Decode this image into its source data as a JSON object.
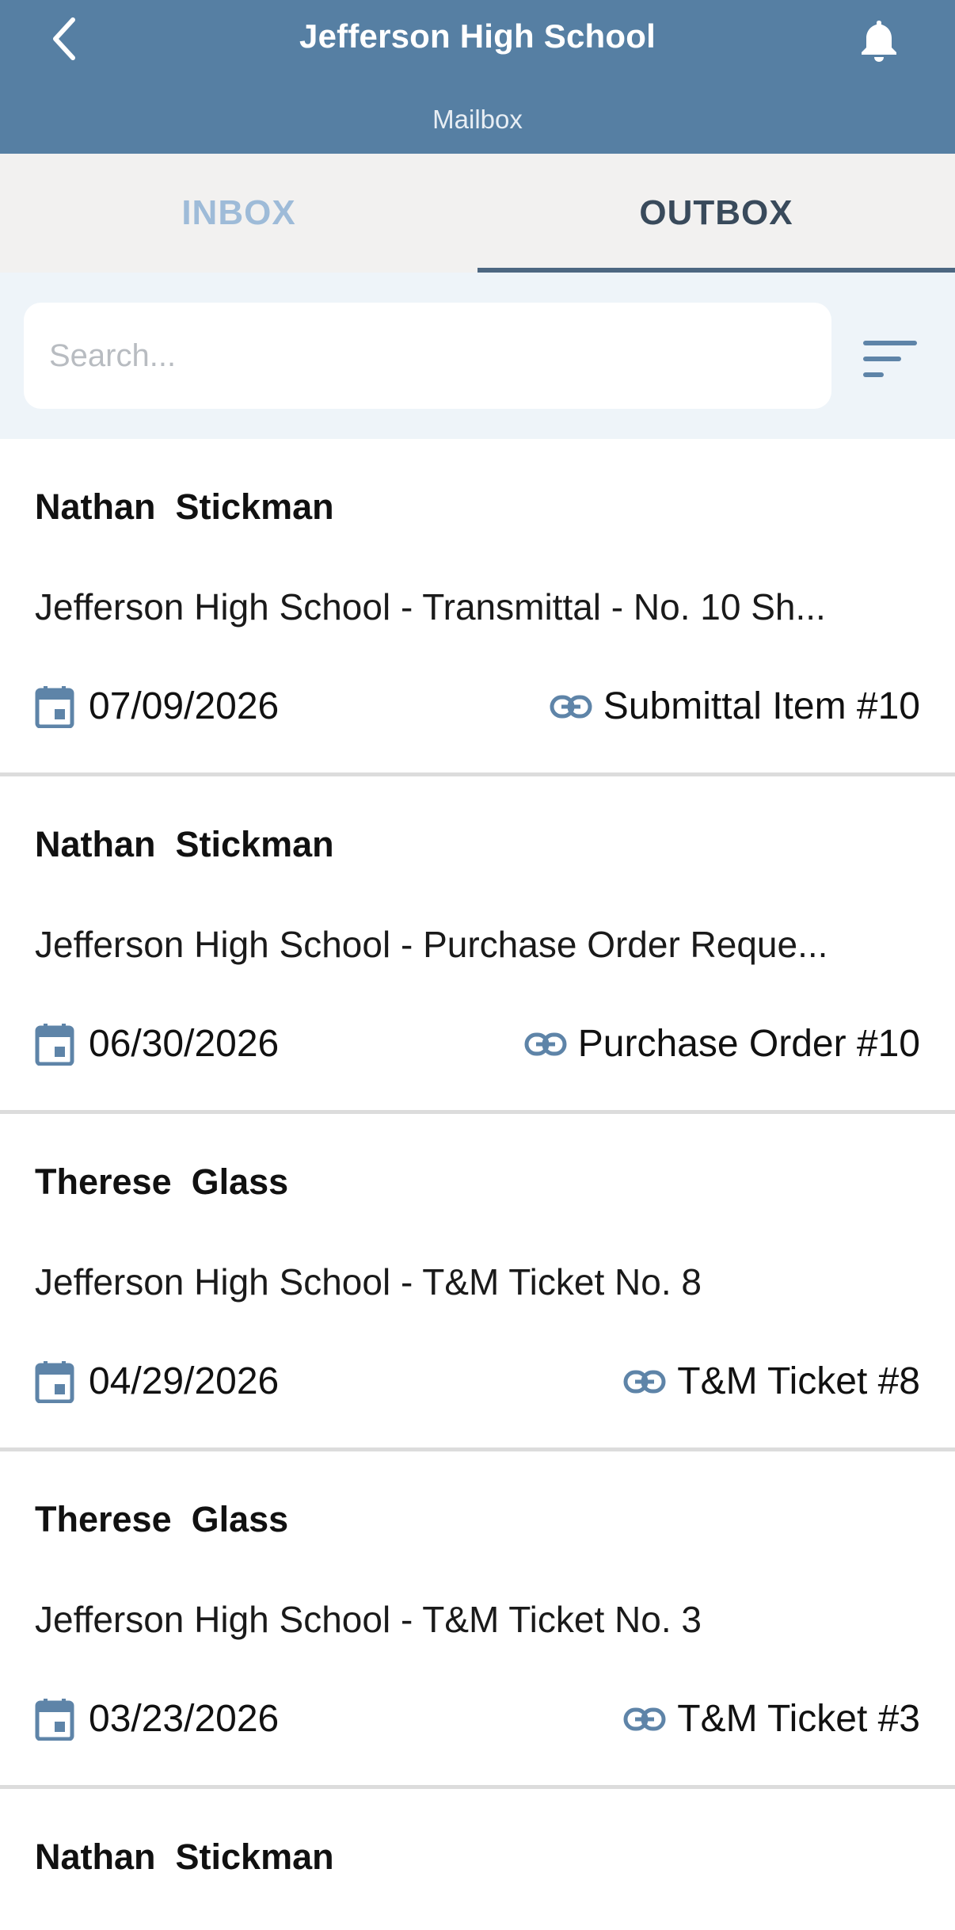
{
  "header": {
    "title": "Jefferson High School",
    "subtitle": "Mailbox",
    "back_icon": "chevron-left-icon",
    "bell_icon": "bell-icon"
  },
  "tabs": [
    {
      "label": "INBOX",
      "active": false
    },
    {
      "label": "OUTBOX",
      "active": true
    }
  ],
  "search": {
    "placeholder": "Search...",
    "value": ""
  },
  "messages": [
    {
      "sender": "Nathan  Stickman",
      "subject": "Jefferson High School - Transmittal - No. 10 Sh...",
      "date": "07/09/2026",
      "reference": "Submittal Item #10"
    },
    {
      "sender": "Nathan  Stickman",
      "subject": "Jefferson High School - Purchase Order Reque...",
      "date": "06/30/2026",
      "reference": "Purchase Order #10"
    },
    {
      "sender": "Therese  Glass",
      "subject": "Jefferson High School - T&M Ticket No. 8",
      "date": "04/29/2026",
      "reference": "T&M Ticket #8"
    },
    {
      "sender": "Therese  Glass",
      "subject": "Jefferson High School - T&M Ticket No. 3",
      "date": "03/23/2026",
      "reference": "T&M Ticket #3"
    },
    {
      "sender": "Nathan  Stickman"
    }
  ],
  "colors": {
    "header_bg": "#567fa3",
    "tab_active": "#394a5b",
    "tab_inactive": "#9ebbd8",
    "icon_blue": "#5e84a8",
    "search_bg": "#eef4f9"
  }
}
